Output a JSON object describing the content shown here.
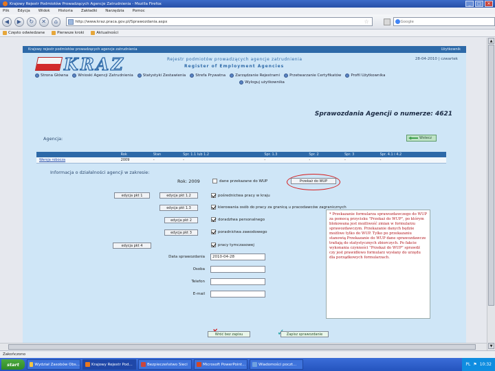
{
  "browser": {
    "window_title": "Krajowy Rejestr Podmiotów Prowadzących Agencje Zatrudnienia - Mozilla Firefox",
    "menu": [
      "Plik",
      "Edycja",
      "Widok",
      "Historia",
      "Zakładki",
      "Narzędzia",
      "Pomoc"
    ],
    "url": "http://www.kraz.praca.gov.pl/Sprawozdania.aspx",
    "search_placeholder": "Google",
    "bookmarks": [
      "Często odwiedzane",
      "Pierwsze kroki",
      "Aktualności"
    ],
    "status": "Zakończono"
  },
  "header": {
    "breadcrumb": "Krajowy rejestr podmiotów prowadzących agencje zatrudnienia",
    "header_right": "Użytkownik",
    "logo_text": "KRAZ",
    "subtitle": "Rejestr podmiotów prowadzących agencje zatrudnienia",
    "subtitle_en": "Register of Employment Agencies",
    "date_info": "28-04-2010 | czwartek"
  },
  "nav": {
    "row1": [
      "Strona Główna",
      "Wnioski Agencji Zatrudnienia",
      "Statystyki Zestawienia",
      "Strefa Prywatna",
      "Zarządzanie Rejestrami",
      "Przetwarzanie Certyfikatów",
      "Profil Użytkownika"
    ],
    "row2": [
      "Wyloguj użytkownika"
    ]
  },
  "report": {
    "title": "Sprawozdania Agencji o numerze: 4621",
    "agencja_label": "Agencja:",
    "back_label": "Wstecz"
  },
  "table": {
    "headers": [
      "",
      "Rok",
      "Stan",
      "Spr. 1.1 lub 1.2",
      "Spr. 1.3",
      "Spr. 2",
      "Spr. 3",
      "Spr. 4.1 i 4.2"
    ],
    "row": [
      "Wersja robocza",
      "2009",
      "-",
      "-",
      "-",
      "-",
      "-",
      "-"
    ]
  },
  "form": {
    "info_label": "Informacja o działalności agencji w zakresie:",
    "rok_label": "Rok: 2009",
    "wup_label": "dane przekazane do WUP",
    "przekaz_btn": "Przekaż do WUP",
    "checks": [
      "pośrednictwa pracy w kraju",
      "kierowania osób do pracy za granicą u pracodawców zagranicznych",
      "doradztwa personalnego",
      "poradnictwa zawodowego",
      "pracy tymczasowej"
    ],
    "edit_buttons": [
      "edycja pkt 1",
      "edycja pkt 1.2",
      "edycja pkt 1.3",
      "edycja pkt 2",
      "edycja pkt 3",
      "edycja pkt 4"
    ],
    "date_label": "Data sprawozdania",
    "date_value": "2010-04-28",
    "osoba_label": "Osoba",
    "telefon_label": "Telefon",
    "email_label": "E-mail",
    "cancel_btn": "Wróć bez zapisu",
    "save_btn": "Zapisz sprawozdanie"
  },
  "note": {
    "text": "* Przekazanie formularza sprawozdawczego do WUP za pomocą przycisku \"Przekaż do WUP\", po którym blokowana jest możliwość zmian w formularzu sprawozdawczym. Przekazanie danych będzie możliwe tylko do WUP. Tylko po przekazaniu stanowią Przekazanie do WUP dane sprawozdawcze trafiają do statystycznych zbiorczych. Po fakcie wykonania czynności \"Przekaż do WUP\" sprawdź czy jest prawidłowo formularz wysłany do urzędu dla porządkowych formularzach."
  },
  "taskbar": {
    "start": "start",
    "tasks": [
      "Wydział Zasobów Obs...",
      "Krajowy Rejestr Pod...",
      "Bezpieczeństwo Sieci",
      "Microsoft PowerPoint...",
      "Wiadomości poczt..."
    ],
    "clock": "10:32"
  },
  "colors": {
    "accent": "#2d69a8",
    "page_bg": "#cfe6f7",
    "highlight": "#d61a1a"
  }
}
